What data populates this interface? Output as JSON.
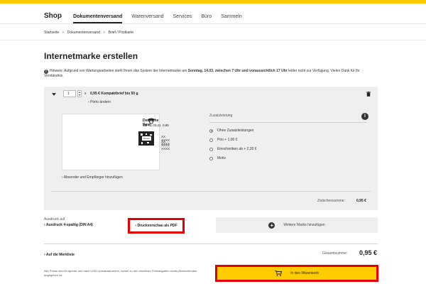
{
  "colors": {
    "brand": "#ffcc00",
    "highlight": "#e40000",
    "card_bg": "#efefef"
  },
  "nav": {
    "brand": "Shop",
    "items": [
      "Dokumentenversand",
      "Warenversand",
      "Services",
      "Büro",
      "Sammeln"
    ],
    "active_index": 0
  },
  "breadcrumb": [
    "Startseite",
    "Dokumentenversand",
    "Brief / Postkarte"
  ],
  "page_title": "Internetmarke erstellen",
  "notice": {
    "icon": "info-icon",
    "prefix": "Hinweis: Aufgrund von Wartungsarbeiten steht Ihnen das System der Internetmarke am ",
    "bold1": "Sonntag, 14.03. zwischen 7 Uhr und voraussichtlich 17 Uhr",
    "suffix": " leider nicht zur Verfügung. Vielen Dank für Ihr Verständnis."
  },
  "card": {
    "quantity": "1",
    "times": "x",
    "product": "0,95 € Kompaktbrief bis 50 g",
    "porto_link": "Porto ändern",
    "stamp": {
      "brand": "Deutsche Post",
      "im_label": "IM",
      "date": "01.03.21",
      "value": "0,95",
      "code_label": "Muster",
      "line1": "XX XXXX XXXX",
      "line2": "XX XXXX XXXX"
    },
    "address_link": "Absender und Empfänger hinzufügen",
    "zusatz_label": "Zusatzleistung",
    "options": [
      {
        "label": "Ohne Zusatzleistungen",
        "checked": true
      },
      {
        "label": "Prio + 1,00 €",
        "checked": false
      },
      {
        "label": "Einschreiben ab + 2,20 €",
        "checked": false
      },
      {
        "label": "Motiv",
        "checked": false
      }
    ],
    "subtotal_label": "Zwischensumme:",
    "subtotal_value": "0,95 €"
  },
  "print": {
    "label": "Ausdruck auf",
    "value": "Ausdruck 4-spaltig (DIN A4)",
    "preview_button": "Druckvorschau als PDF"
  },
  "add_button": "Weitere Marke hinzufügen",
  "merkliste": "Auf die Merkliste",
  "total_label": "Gesamtsumme:",
  "total_value": "0,95 €",
  "footnote": "Alle Preise sind Endpreise und nach UStG umsatzsteuerfrei, soweit zu den einzelnen Preisangaben nichts Abweichendes angegeben ist.",
  "cart_button": "In den Warenkorb"
}
